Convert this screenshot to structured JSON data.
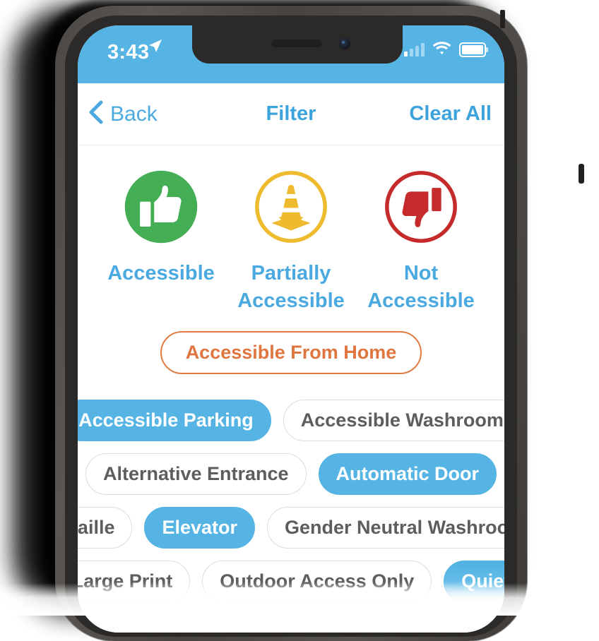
{
  "status_bar": {
    "time": "3:43",
    "location_icon": "location-arrow-icon",
    "signal_icon": "cellular-signal-icon",
    "signal_bars_filled": 1,
    "signal_bars_total": 4,
    "wifi_icon": "wifi-icon",
    "battery_icon": "battery-full-icon",
    "background_color": "#55b4e3"
  },
  "navbar": {
    "back_label": "Back",
    "back_icon": "chevron-left-icon",
    "title": "Filter",
    "clear_all_label": "Clear All",
    "accent_color": "#3da3dd"
  },
  "status_options": [
    {
      "label": "Accessible",
      "icon": "thumbs-up-icon",
      "color": "#43ae54",
      "selected": false
    },
    {
      "label": "Partially Accessible",
      "icon": "traffic-cone-icon",
      "color": "#eeba2e",
      "selected": false
    },
    {
      "label": "Not Accessible",
      "icon": "thumbs-down-icon",
      "color": "#c62b2b",
      "selected": false
    }
  ],
  "home_filter": {
    "label": "Accessible From Home",
    "color": "#df7640",
    "selected": false
  },
  "feature_chips": {
    "selected_color": "#55b4e3",
    "unselected_text_color": "#5d5d5d",
    "rows": [
      [
        {
          "label": "Accessible Parking",
          "selected": true
        },
        {
          "label": "Accessible Washroom",
          "selected": false
        }
      ],
      [
        {
          "label": "Alternative Entrance",
          "selected": false
        },
        {
          "label": "Automatic Door",
          "selected": true
        }
      ],
      [
        {
          "label": "Braille",
          "selected": false
        },
        {
          "label": "Elevator",
          "selected": true
        },
        {
          "label": "Gender Neutral Washroom",
          "selected": false
        }
      ],
      [
        {
          "label": "Large Print",
          "selected": false
        },
        {
          "label": "Outdoor Access Only",
          "selected": false
        },
        {
          "label": "Quiet",
          "selected": true
        }
      ]
    ]
  }
}
